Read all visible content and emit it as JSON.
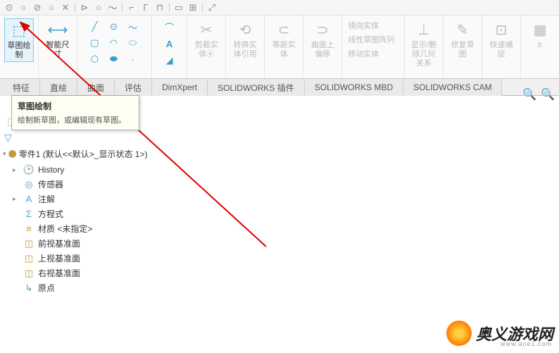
{
  "top_icons": [
    "⊙",
    "○",
    "⊘",
    "○",
    "✕",
    "⊳",
    "○",
    "〜",
    "⌐",
    "Γ",
    "⊓",
    "▭",
    "⊞",
    "⤢"
  ],
  "ribbon": {
    "sketch": "草图绘制",
    "smartdim": "智能尺寸",
    "trim": "剪裁实体④",
    "convert": "转换实体引用",
    "offset_entity": "等距实体",
    "offset_curve": "曲面上偏移",
    "mirror": "镜向实体",
    "pattern": "线性草图阵列",
    "move": "移动实体",
    "relations": "显示/删除几何关系",
    "repair": "修复草图",
    "quicksnap": "快速捕捉",
    "instant": "Ir"
  },
  "tabs": [
    "特征",
    "直绘",
    "曲面",
    "评估",
    "DimXpert",
    "SOLIDWORKS 插件",
    "SOLIDWORKS MBD",
    "SOLIDWORKS CAM"
  ],
  "tooltip": {
    "title": "草图绘制",
    "body": "绘制新草图，或编辑现有草图。"
  },
  "part_title": "零件1 (默认<<默认>_显示状态 1>)",
  "tree": [
    {
      "icon": "🕑",
      "label": "History",
      "color": "ic-blue",
      "expand": "▸"
    },
    {
      "icon": "◎",
      "label": "传感器",
      "color": "ic-blue",
      "expand": ""
    },
    {
      "icon": "A",
      "label": "注解",
      "color": "ic-blue",
      "expand": "▸"
    },
    {
      "icon": "Σ",
      "label": "方程式",
      "color": "ic-blue",
      "expand": ""
    },
    {
      "icon": "≡",
      "label": "材质 <未指定>",
      "color": "ic-gold",
      "expand": ""
    },
    {
      "icon": "◫",
      "label": "前视基准面",
      "color": "ic-gold",
      "expand": ""
    },
    {
      "icon": "◫",
      "label": "上视基准面",
      "color": "ic-gold",
      "expand": ""
    },
    {
      "icon": "◫",
      "label": "右视基准面",
      "color": "ic-gold",
      "expand": ""
    },
    {
      "icon": "↳",
      "label": "原点",
      "color": "ic-blue",
      "expand": ""
    }
  ],
  "watermark": {
    "text": "奥义游戏网",
    "url": "www.aoe1.com"
  }
}
